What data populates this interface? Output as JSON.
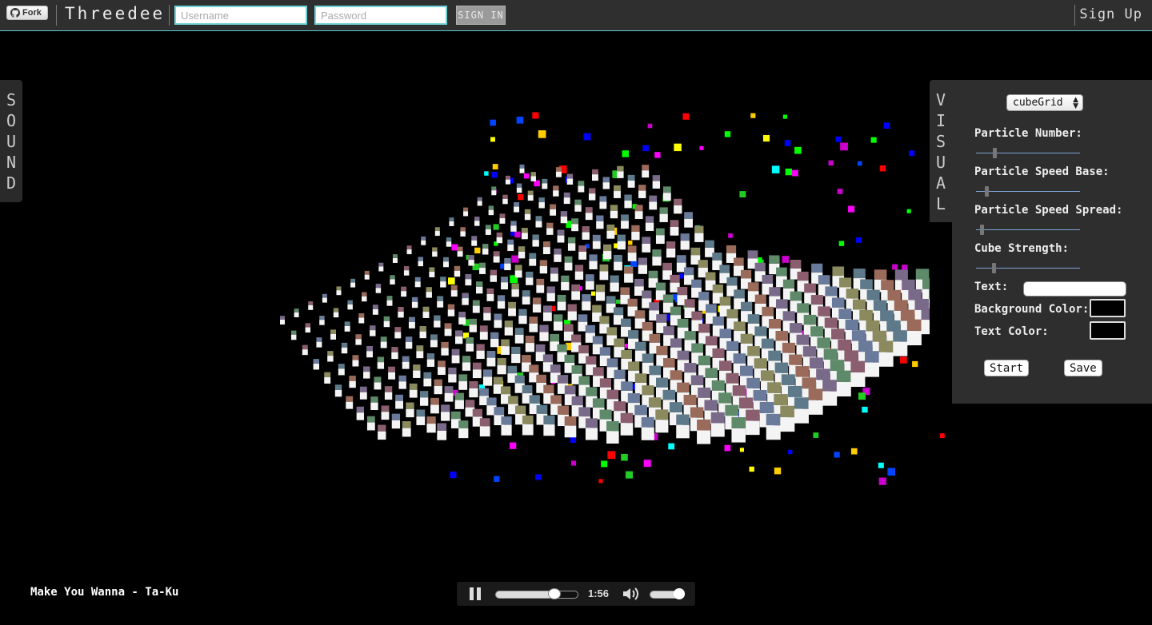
{
  "header": {
    "fork_label": "Fork",
    "brand": "Threedee",
    "username_placeholder": "Username",
    "password_placeholder": "Password",
    "signin_label": "SIGN IN",
    "signup_label": "Sign Up"
  },
  "sound_tab": {
    "label": "S\nO\nU\nN\nD"
  },
  "visual_tab": {
    "label": "V\nI\nS\nU\nA\nL"
  },
  "visual_settings": {
    "mode_selected": "cubeGrid",
    "particle_number_label": "Particle Number:",
    "particle_number_value": 0.17,
    "particle_speed_base_label": "Particle Speed Base:",
    "particle_speed_base_value": 0.09,
    "particle_speed_spread_label": "Particle Speed Spread:",
    "particle_speed_spread_value": 0.04,
    "cube_strength_label": "Cube Strength:",
    "cube_strength_value": 0.16,
    "text_label": "Text:",
    "text_value": "",
    "background_color_label": "Background Color:",
    "background_color": "#000000",
    "text_color_label": "Text Color:",
    "text_color": "#000000",
    "start_label": "Start",
    "save_label": "Save"
  },
  "player": {
    "track_title": "Make You Wanna - Ta-Ku",
    "time": "1:56",
    "progress": 0.72,
    "volume": 0.85,
    "state": "playing"
  },
  "colors": {
    "topbar_bg": "#2f2f2f",
    "accent": "#58c8d0",
    "panel_bg": "#2e2e2e"
  }
}
